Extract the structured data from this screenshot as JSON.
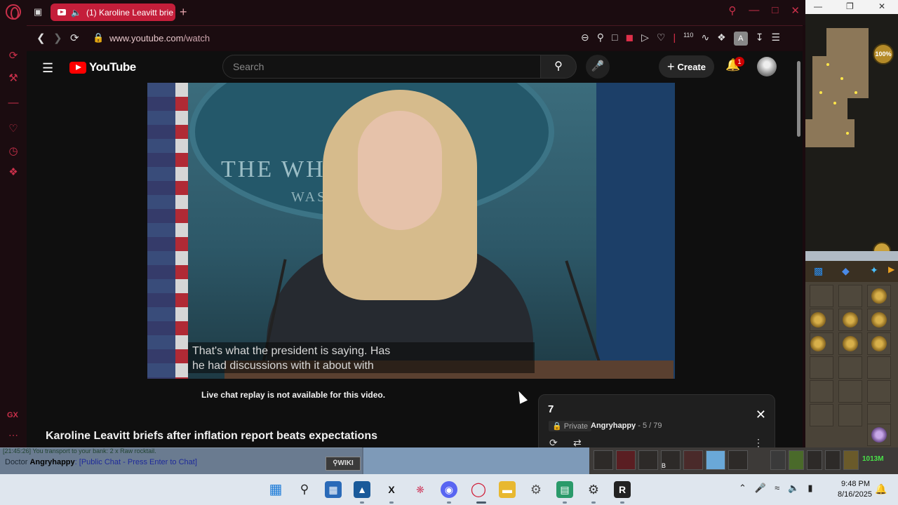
{
  "browser": {
    "tab_title": "(1) Karoline Leavitt brie",
    "url_domain": "www.youtube.com",
    "url_path": "/watch",
    "extension_badge": "110",
    "profile_initial": "A",
    "sidebar_gx": "GX",
    "accent_color": "#c9304a"
  },
  "youtube": {
    "logo_text": "YouTube",
    "search_placeholder": "Search",
    "create_label": "Create",
    "notification_count": "1",
    "caption_line1": "That's what the president is saying. Has",
    "caption_line2": "he had discussions with it about with",
    "video_overlay_text1": "THE WHITE HOUSE",
    "video_overlay_text2": "WASH",
    "live_chat_message": "Live chat replay is not available for this video.",
    "video_title": "Karoline Leavitt briefs after inflation report beats expectations",
    "playlist": {
      "title": "7",
      "privacy": "Private",
      "owner": "Angryhappy",
      "position": "- 5 / 79"
    }
  },
  "game": {
    "zoom_percent": "100%",
    "chat_prefix": "[21:45:26]",
    "chat_top_line": "You transport to your bank: 2 x Raw rocktail.",
    "chat_rank": "Doctor",
    "chat_name": "Angryhappy",
    "chat_hint": ": [Public Chat - Press Enter to Chat]",
    "wiki_label": "WIKI",
    "money": "1013M",
    "hotkey_label": "B"
  },
  "taskbar": {
    "time": "9:48 PM",
    "date": "8/16/2025"
  }
}
